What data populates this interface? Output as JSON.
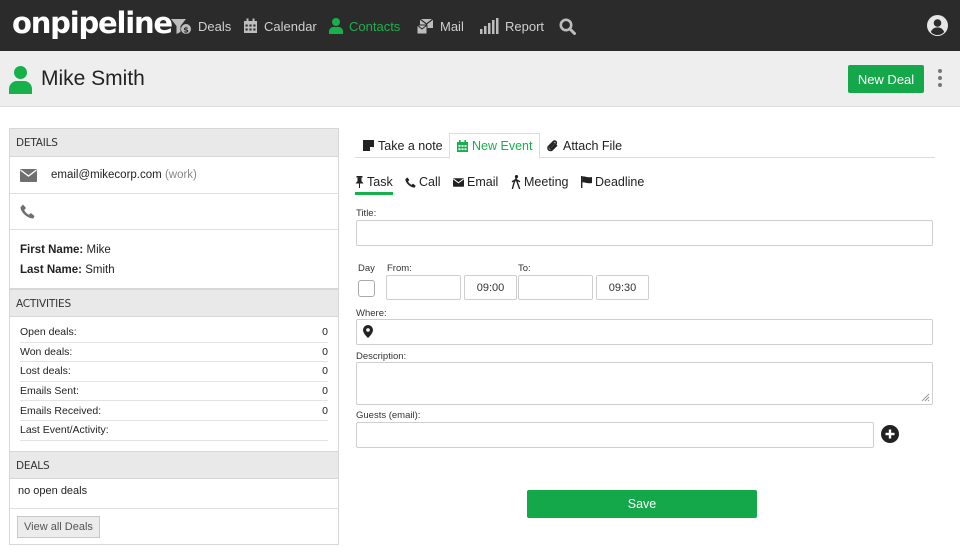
{
  "app": {
    "logo": "onpipeline"
  },
  "nav": {
    "items": [
      {
        "label": "Deals",
        "icon": "deals-funnel-icon"
      },
      {
        "label": "Calendar",
        "icon": "calendar-icon"
      },
      {
        "label": "Contacts",
        "icon": "person-icon",
        "active": true
      },
      {
        "label": "Mail",
        "icon": "mail-icon"
      },
      {
        "label": "Report",
        "icon": "bar-chart-icon"
      }
    ],
    "search_icon": "search-icon",
    "user_icon": "user-circle-icon"
  },
  "header": {
    "title": "Mike Smith",
    "new_deal_label": "New Deal"
  },
  "details": {
    "heading": "Details",
    "email": "email@mikecorp.com",
    "email_type": "(work)",
    "first_name_label": "First Name:",
    "first_name": "Mike",
    "last_name_label": "Last Name:",
    "last_name": "Smith"
  },
  "activities": {
    "heading": "Activities",
    "rows": [
      {
        "label": "Open deals:",
        "value": "0"
      },
      {
        "label": "Won deals:",
        "value": "0"
      },
      {
        "label": "Lost deals:",
        "value": "0"
      },
      {
        "label": "Emails Sent:",
        "value": "0"
      },
      {
        "label": "Emails Received:",
        "value": "0"
      },
      {
        "label": "Last Event/Activity:",
        "value": ""
      }
    ]
  },
  "deals": {
    "heading": "Deals",
    "empty_text": "no open deals",
    "view_all_label": "View all Deals"
  },
  "tabs": [
    {
      "label": "Take a note",
      "icon": "note-icon"
    },
    {
      "label": "New Event",
      "icon": "calendar-icon",
      "active": true
    },
    {
      "label": "Attach File",
      "icon": "paperclip-icon"
    }
  ],
  "event_types": [
    {
      "label": "Task",
      "icon": "pin-icon",
      "active": true
    },
    {
      "label": "Call",
      "icon": "phone-icon"
    },
    {
      "label": "Email",
      "icon": "envelope-icon"
    },
    {
      "label": "Meeting",
      "icon": "walking-person-icon"
    },
    {
      "label": "Deadline",
      "icon": "flag-icon"
    }
  ],
  "form": {
    "title_label": "Title:",
    "title_value": "",
    "day_label": "Day",
    "from_label": "From:",
    "to_label": "To:",
    "from_date": "",
    "from_time": "09:00",
    "to_date": "",
    "to_time": "09:30",
    "where_label": "Where:",
    "where_value": "",
    "description_label": "Description:",
    "description_value": "",
    "guests_label": "Guests (email):",
    "guests_value": "",
    "save_label": "Save"
  },
  "colors": {
    "accent": "#17b14c",
    "button": "#14a84a",
    "topbar": "#2b2b2b",
    "header": "#efeeee"
  }
}
